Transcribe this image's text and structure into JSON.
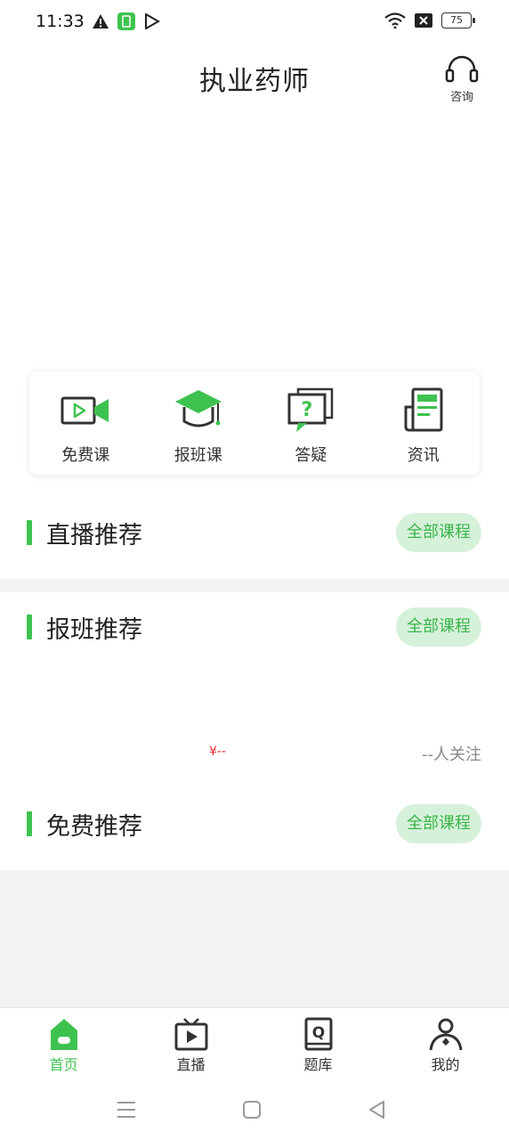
{
  "status": {
    "time": "11:33",
    "battery": "75"
  },
  "header": {
    "title": "执业药师",
    "consult_label": "咨询"
  },
  "shortcuts": [
    {
      "label": "免费课",
      "icon": "video-camera-icon"
    },
    {
      "label": "报班课",
      "icon": "graduation-cap-icon"
    },
    {
      "label": "答疑",
      "icon": "question-chat-icon"
    },
    {
      "label": "资讯",
      "icon": "newspaper-icon"
    }
  ],
  "sections": {
    "live": {
      "title": "直播推荐",
      "more_label": "全部课程"
    },
    "classes": {
      "title": "报班推荐",
      "more_label": "全部课程",
      "price": "¥--",
      "followers": "--人关注"
    },
    "free": {
      "title": "免费推荐",
      "more_label": "全部课程"
    }
  },
  "tabbar": [
    {
      "label": "首页",
      "icon": "home-icon",
      "active": true
    },
    {
      "label": "直播",
      "icon": "tv-play-icon",
      "active": false
    },
    {
      "label": "题库",
      "icon": "question-book-icon",
      "active": false
    },
    {
      "label": "我的",
      "icon": "user-icon",
      "active": false
    }
  ],
  "colors": {
    "accent": "#3ec24f",
    "accent_light": "#d6f1da",
    "price_red": "#e03131",
    "divider": "#f2f2f2"
  }
}
